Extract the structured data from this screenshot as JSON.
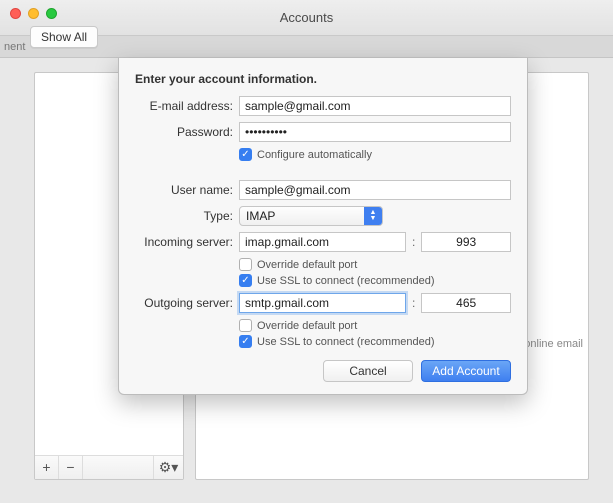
{
  "window": {
    "title": "Accounts",
    "show_all": "Show All"
  },
  "toolstrip": {
    "left_fragment": "nent"
  },
  "right_panel": {
    "hint_fragment": "online email"
  },
  "sheet": {
    "heading": "Enter your account information.",
    "labels": {
      "email": "E-mail address:",
      "password": "Password:",
      "user": "User name:",
      "type": "Type:",
      "incoming": "Incoming server:",
      "outgoing": "Outgoing server:"
    },
    "values": {
      "email": "sample@gmail.com",
      "password": "••••••••••",
      "user": "sample@gmail.com",
      "type": "IMAP",
      "incoming": "imap.gmail.com",
      "incoming_port": "993",
      "outgoing": "smtp.gmail.com",
      "outgoing_port": "465"
    },
    "checks": {
      "configure": "Configure automatically",
      "override_in": "Override default port",
      "ssl_in": "Use SSL to connect (recommended)",
      "override_out": "Override default port",
      "ssl_out": "Use SSL to connect (recommended)"
    },
    "buttons": {
      "cancel": "Cancel",
      "add": "Add Account"
    }
  }
}
